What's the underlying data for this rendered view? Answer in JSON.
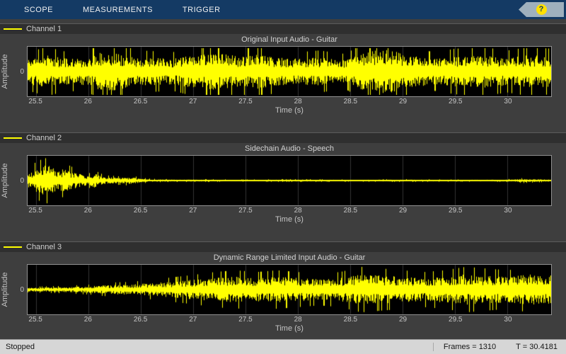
{
  "toolbar": {
    "tabs": [
      {
        "label": "SCOPE"
      },
      {
        "label": "MEASUREMENTS"
      },
      {
        "label": "TRIGGER"
      }
    ],
    "help": {
      "label": "?"
    }
  },
  "axis": {
    "xmin": 25.4181,
    "xmax": 30.4181,
    "ticks": [
      25.5,
      26,
      26.5,
      27,
      27.5,
      28,
      28.5,
      29,
      29.5,
      30
    ],
    "tick_labels": [
      "25.5",
      "26",
      "26.5",
      "27",
      "27.5",
      "28",
      "28.5",
      "29",
      "29.5",
      "30"
    ],
    "xlabel": "Time (s)",
    "ylabel": "Amplitude",
    "y_tick": "0"
  },
  "channels": [
    {
      "legend": "Channel 1",
      "title": "Original Input Audio - Guitar"
    },
    {
      "legend": "Channel 2",
      "title": "Sidechain Audio - Speech"
    },
    {
      "legend": "Channel 3",
      "title": "Dynamic Range Limited Input Audio - Guitar"
    }
  ],
  "status": {
    "state": "Stopped",
    "frames": "Frames = 1310",
    "time": "T = 30.4181"
  },
  "colors": {
    "line": "#ffff00",
    "grid": "#343434",
    "plot_bg": "#000000",
    "toolbar_bg": "#143a64",
    "axis_border": "#909090"
  },
  "chart_data": [
    {
      "type": "line",
      "title": "Original Input Audio - Guitar",
      "series_name": "Channel 1",
      "color": "#ffff00",
      "xlabel": "Time (s)",
      "ylabel": "Amplitude",
      "xlim": [
        25.4181,
        30.4181
      ],
      "x_ticks": [
        25.5,
        26,
        26.5,
        27,
        27.5,
        28,
        28.5,
        29,
        29.5,
        30
      ],
      "y_ticks": [
        0
      ],
      "noise_seed": 11,
      "amplitude_envelope": [
        [
          25.42,
          0.55
        ],
        [
          25.6,
          0.7
        ],
        [
          25.8,
          0.55
        ],
        [
          26.0,
          0.6
        ],
        [
          26.15,
          0.9
        ],
        [
          26.35,
          0.75
        ],
        [
          26.5,
          0.6
        ],
        [
          26.8,
          0.55
        ],
        [
          27.0,
          0.7
        ],
        [
          27.2,
          0.8
        ],
        [
          27.45,
          0.65
        ],
        [
          27.6,
          0.75
        ],
        [
          27.8,
          0.6
        ],
        [
          28.0,
          0.55
        ],
        [
          28.2,
          0.6
        ],
        [
          28.45,
          0.5
        ],
        [
          28.65,
          0.85
        ],
        [
          28.85,
          0.95
        ],
        [
          29.05,
          0.7
        ],
        [
          29.3,
          0.55
        ],
        [
          29.5,
          0.65
        ],
        [
          29.75,
          0.7
        ],
        [
          30.0,
          0.6
        ],
        [
          30.2,
          0.7
        ],
        [
          30.42,
          0.65
        ]
      ]
    },
    {
      "type": "line",
      "title": "Sidechain Audio - Speech",
      "series_name": "Channel 2",
      "color": "#ffff00",
      "xlabel": "Time (s)",
      "ylabel": "Amplitude",
      "xlim": [
        25.4181,
        30.4181
      ],
      "x_ticks": [
        25.5,
        26,
        26.5,
        27,
        27.5,
        28,
        28.5,
        29,
        29.5,
        30
      ],
      "y_ticks": [
        0
      ],
      "noise_seed": 22,
      "amplitude_envelope": [
        [
          25.42,
          0.3
        ],
        [
          25.5,
          0.55
        ],
        [
          25.6,
          0.65
        ],
        [
          25.7,
          0.5
        ],
        [
          25.8,
          0.45
        ],
        [
          25.9,
          0.3
        ],
        [
          26.0,
          0.2
        ],
        [
          26.05,
          0.3
        ],
        [
          26.15,
          0.15
        ],
        [
          26.3,
          0.12
        ],
        [
          26.4,
          0.15
        ],
        [
          26.5,
          0.08
        ],
        [
          26.6,
          0.05
        ],
        [
          26.8,
          0.04
        ],
        [
          27.0,
          0.04
        ],
        [
          27.5,
          0.03
        ],
        [
          28.0,
          0.04
        ],
        [
          28.5,
          0.03
        ],
        [
          29.0,
          0.04
        ],
        [
          29.5,
          0.03
        ],
        [
          30.0,
          0.04
        ],
        [
          30.15,
          0.07
        ],
        [
          30.3,
          0.05
        ],
        [
          30.42,
          0.04
        ]
      ]
    },
    {
      "type": "line",
      "title": "Dynamic Range Limited Input Audio - Guitar",
      "series_name": "Channel 3",
      "color": "#ffff00",
      "xlabel": "Time (s)",
      "ylabel": "Amplitude",
      "xlim": [
        25.4181,
        30.4181
      ],
      "x_ticks": [
        25.5,
        26,
        26.5,
        27,
        27.5,
        28,
        28.5,
        29,
        29.5,
        30
      ],
      "y_ticks": [
        0
      ],
      "noise_seed": 33,
      "amplitude_envelope": [
        [
          25.42,
          0.08
        ],
        [
          25.7,
          0.1
        ],
        [
          26.0,
          0.14
        ],
        [
          26.2,
          0.2
        ],
        [
          26.4,
          0.22
        ],
        [
          26.6,
          0.28
        ],
        [
          26.8,
          0.35
        ],
        [
          27.0,
          0.42
        ],
        [
          27.2,
          0.5
        ],
        [
          27.4,
          0.55
        ],
        [
          27.6,
          0.5
        ],
        [
          27.8,
          0.55
        ],
        [
          28.0,
          0.5
        ],
        [
          28.2,
          0.45
        ],
        [
          28.4,
          0.5
        ],
        [
          28.6,
          0.65
        ],
        [
          28.8,
          0.6
        ],
        [
          29.0,
          0.55
        ],
        [
          29.2,
          0.5
        ],
        [
          29.4,
          0.55
        ],
        [
          29.6,
          0.65
        ],
        [
          29.8,
          0.6
        ],
        [
          30.0,
          0.55
        ],
        [
          30.2,
          0.65
        ],
        [
          30.42,
          0.6
        ]
      ]
    }
  ]
}
